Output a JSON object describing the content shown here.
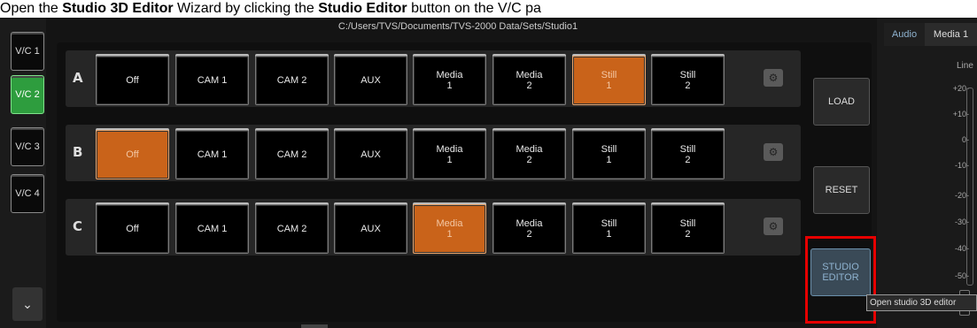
{
  "caption": {
    "text_before": "Open the ",
    "bold_1": "Studio 3D Editor",
    "text_mid": " Wizard by clicking the ",
    "bold_2": "Studio Editor",
    "text_after": " button on the V/C pa"
  },
  "file_path": "C:/Users/TVS/Documents/TVS-2000 Data/Sets/Studio1",
  "vc_buttons": [
    {
      "label": "V/C 1",
      "active": false
    },
    {
      "label": "V/C 2",
      "active": true
    },
    {
      "label": "V/C 3",
      "active": false
    },
    {
      "label": "V/C 4",
      "active": false
    }
  ],
  "rows": [
    {
      "label": "A",
      "active_index": 6
    },
    {
      "label": "B",
      "active_index": 0
    },
    {
      "label": "C",
      "active_index": 4
    }
  ],
  "sources": [
    "Off",
    "CAM 1",
    "CAM 2",
    "AUX",
    "Media\n1",
    "Media\n2",
    "Still\n1",
    "Still\n2"
  ],
  "side_buttons": {
    "load": "LOAD",
    "reset": "RESET",
    "studio_editor": "STUDIO\nEDITOR"
  },
  "tooltip": "Open studio 3D editor",
  "right_panel": {
    "tab_audio": "Audio",
    "tab_media": "Media 1",
    "line_label": "Line",
    "ticks": [
      "+20-",
      "+10-",
      "0-",
      "-10-",
      "-20-",
      "-30-",
      "-40-",
      "-50-"
    ]
  },
  "icons": {
    "gear": "gear-icon",
    "chevron": "chevron-down-icon"
  },
  "colors": {
    "active_green": "#2e9d3e",
    "selected_orange": "#c9631a",
    "highlight_red": "#e60000"
  }
}
